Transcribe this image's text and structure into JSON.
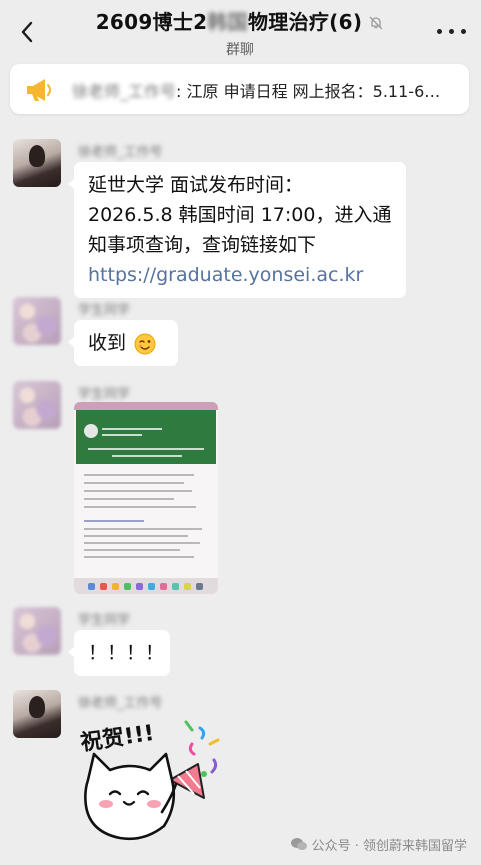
{
  "header": {
    "title_prefix": "2609博士2",
    "title_hidden": "韩国",
    "title_suffix": "物理治疗(6)",
    "subtitle": "群聊"
  },
  "notice": {
    "sender": "徐老师_工作号",
    "text": ": 江原 申请日程 网上报名：5.11-6…"
  },
  "messages": [
    {
      "sender": "徐老师_工作号",
      "lines": [
        "延世大学 面试发布时间：",
        "2026.5.8 韩国时间 17:00，进入通",
        "知事项查询，查询链接如下"
      ],
      "link": "https://graduate.yonsei.ac.kr"
    },
    {
      "sender": "学生同学",
      "text": "收到",
      "emoji": "wink"
    },
    {
      "sender": "学生同学",
      "kind": "image"
    },
    {
      "sender": "学生同学",
      "text": "！！！！"
    },
    {
      "sender": "徐老师_工作号",
      "kind": "sticker",
      "sticker_text": "祝贺!!!"
    }
  ],
  "watermark": "公众号 · 领创蔚来韩国留学",
  "colors": {
    "background": "#ededed",
    "bubble": "#ffffff",
    "link": "#56739d",
    "megaphone": "#f5b632"
  }
}
